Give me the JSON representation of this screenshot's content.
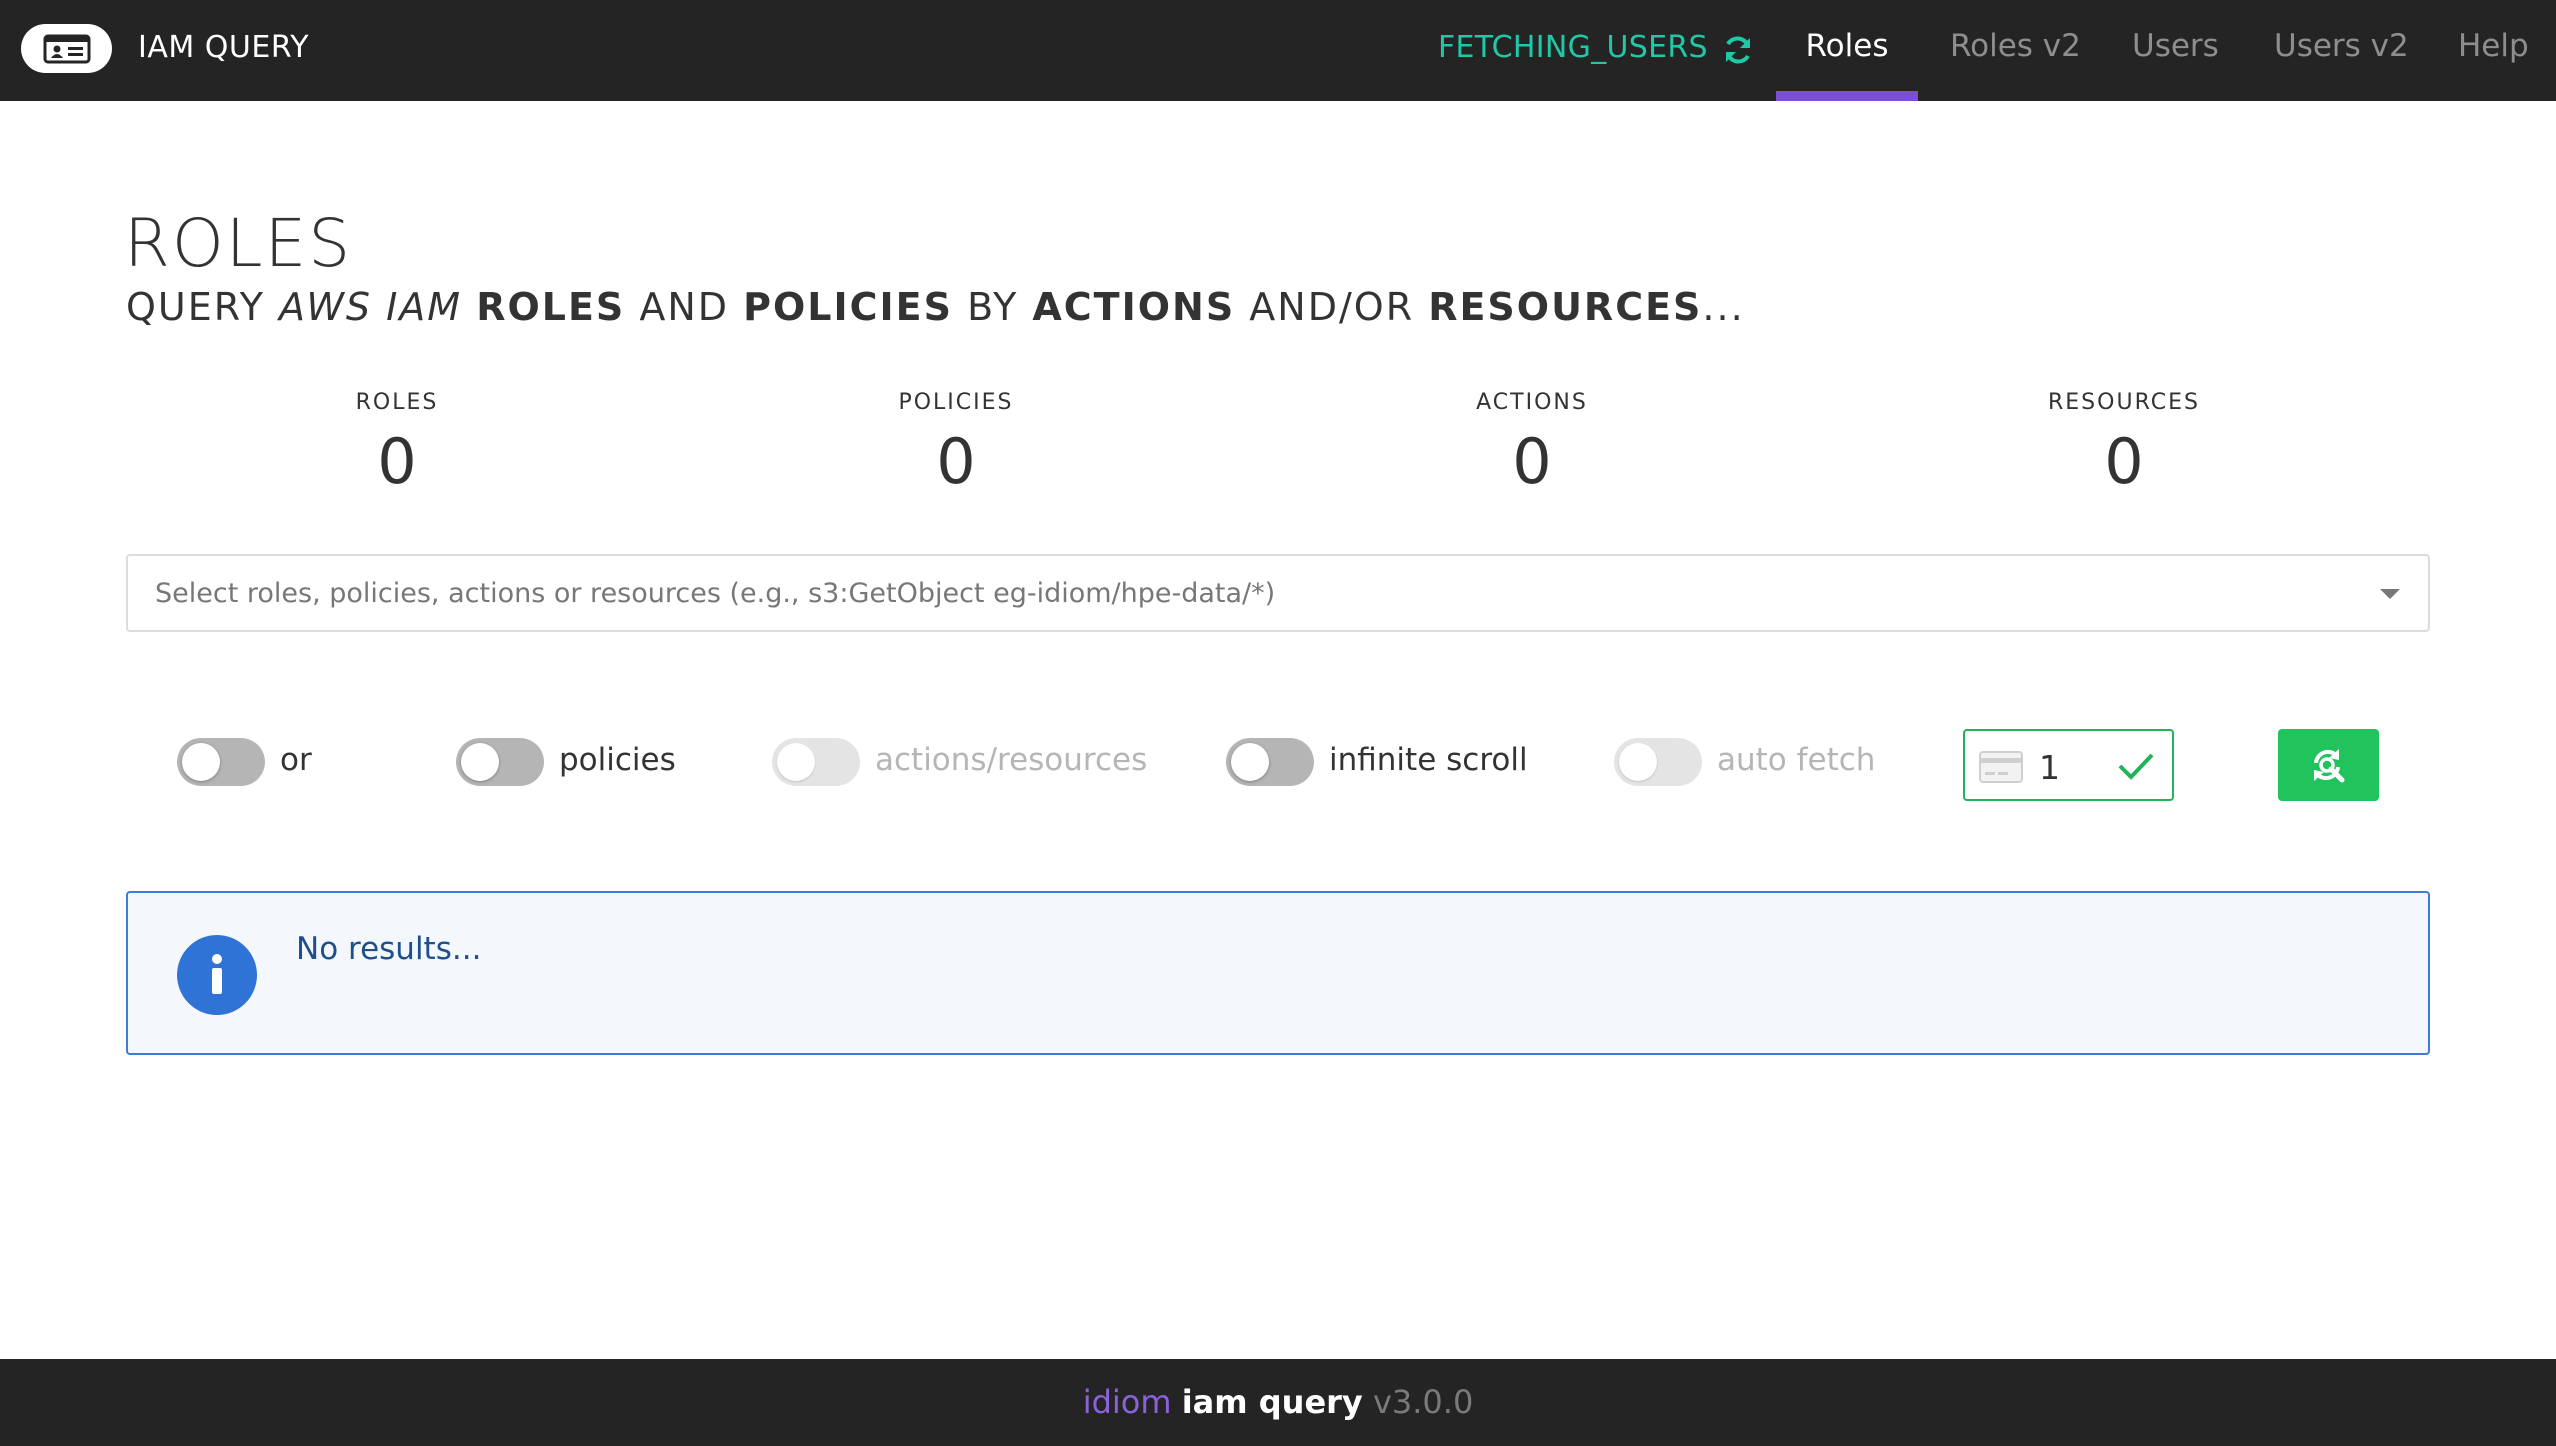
{
  "app": {
    "title": "IAM QUERY"
  },
  "nav": {
    "status": "FETCHING_USERS",
    "tabs": [
      {
        "label": "Roles",
        "active": true
      },
      {
        "label": "Roles v2",
        "active": false
      },
      {
        "label": "Users",
        "active": false
      },
      {
        "label": "Users v2",
        "active": false
      },
      {
        "label": "Help",
        "active": false
      }
    ]
  },
  "header": {
    "title": "ROLES",
    "subtitle": {
      "p1": "QUERY ",
      "p2": "AWS IAM",
      "p3": " ",
      "p4": "ROLES",
      "p5": " AND ",
      "p6": "POLICIES",
      "p7": " BY ",
      "p8": "ACTIONS",
      "p9": " AND/OR ",
      "p10": "RESOURCES",
      "p11": "..."
    }
  },
  "stats": [
    {
      "label": "ROLES",
      "value": "0"
    },
    {
      "label": "POLICIES",
      "value": "0"
    },
    {
      "label": "ACTIONS",
      "value": "0"
    },
    {
      "label": "RESOURCES",
      "value": "0"
    }
  ],
  "search": {
    "placeholder": "Select roles, policies, actions or resources (e.g., s3:GetObject eg-idiom/hpe-data/*)"
  },
  "toggles": [
    {
      "label": "or",
      "on": false,
      "disabled": false
    },
    {
      "label": "policies",
      "on": false,
      "disabled": false
    },
    {
      "label": "actions/resources",
      "on": false,
      "disabled": true
    },
    {
      "label": "infinite scroll",
      "on": false,
      "disabled": false
    },
    {
      "label": "auto fetch",
      "on": false,
      "disabled": true
    }
  ],
  "page_input": {
    "value": "1"
  },
  "message": {
    "text": "No results..."
  },
  "footer": {
    "brand": "idiom",
    "product": "iam query",
    "version": "v3.0.0"
  },
  "colors": {
    "accent": "#7b4fd6",
    "status": "#21c8a7",
    "success": "#21c35c",
    "info": "#2f73d6"
  }
}
